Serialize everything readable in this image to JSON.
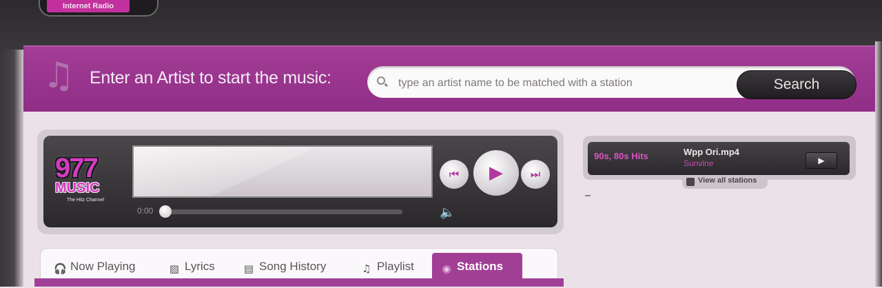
{
  "header": {
    "logo_text": "Internet Radio"
  },
  "search": {
    "prompt": "Enter an Artist to start the music:",
    "placeholder": "type an artist name to be matched with a station",
    "button_label": "Search"
  },
  "player": {
    "logo": {
      "number": "977",
      "word": "MUSIC",
      "tagline": "The Hitz Channel"
    },
    "time_elapsed": "0:00",
    "progress": 0
  },
  "tabs": [
    {
      "label": "Now Playing",
      "icon": "headphones-icon"
    },
    {
      "label": "Lyrics",
      "icon": "image-icon"
    },
    {
      "label": "Song History",
      "icon": "history-icon"
    },
    {
      "label": "Playlist",
      "icon": "music-note-icon"
    },
    {
      "label": "Stations",
      "icon": "radio-signal-icon",
      "active": true
    }
  ],
  "side_widget": {
    "station": "90s, 80s Hits",
    "title": "Wpp Ori.mp4",
    "artist": "Sunvine",
    "view_label": "View all stations"
  },
  "colors": {
    "accent": "#a13f96",
    "topbar": "#333033",
    "background": "#ebe2e9"
  }
}
